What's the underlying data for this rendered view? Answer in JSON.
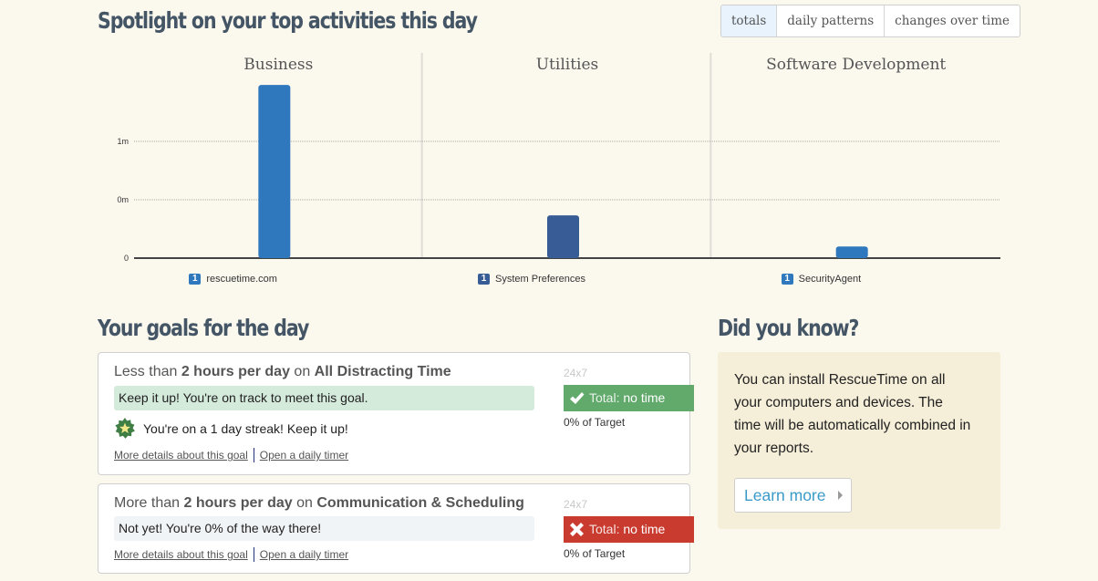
{
  "spotlight": {
    "title": "Spotlight on your top activities this day",
    "view_tabs": [
      {
        "label": "totals",
        "active": true
      },
      {
        "label": "daily patterns",
        "active": false
      },
      {
        "label": "changes over time",
        "active": false
      }
    ]
  },
  "chart_data": {
    "type": "bar",
    "title": "Spotlight on your top activities this day",
    "xlabel": "",
    "ylabel": "",
    "y_unit": "seconds",
    "ylim": [
      0,
      95
    ],
    "y_ticks": [
      {
        "value": 0,
        "label": "0"
      },
      {
        "value": 30,
        "label": "0m"
      },
      {
        "value": 60,
        "label": "1m"
      }
    ],
    "grid": true,
    "categories": [
      "Business",
      "Utilities",
      "Software Development"
    ],
    "series": [
      {
        "category": "Business",
        "rank": "1",
        "name": "rescuetime.com",
        "value": 89,
        "color": "#2f78bd"
      },
      {
        "category": "Utilities",
        "rank": "1",
        "name": "System Preferences",
        "value": 22,
        "color": "#385c96"
      },
      {
        "category": "Software Development",
        "rank": "1",
        "name": "SecurityAgent",
        "value": 6,
        "color": "#2f78bd"
      }
    ]
  },
  "goals": {
    "title": "Your goals for the day",
    "items": [
      {
        "prefix": "Less than ",
        "amount": "2 hours per day",
        "middle": " on ",
        "category": "All Distracting Time",
        "message": "Keep it up! You're on track to meet this goal.",
        "status": "ok",
        "streak": "You're on a 1 day streak! Keep it up!",
        "schedule": "24x7",
        "total_label": "Total:",
        "total_value": "no time",
        "percent": "0% of Target",
        "link_details": "More details about this goal",
        "link_timer": "Open a daily timer"
      },
      {
        "prefix": "More than ",
        "amount": "2 hours per day",
        "middle": " on ",
        "category": "Communication & Scheduling",
        "message": "Not yet! You're 0% of the way there!",
        "status": "fail",
        "schedule": "24x7",
        "total_label": "Total:",
        "total_value": "no time",
        "percent": "0% of Target",
        "link_details": "More details about this goal",
        "link_timer": "Open a daily timer"
      }
    ]
  },
  "did_you_know": {
    "title": "Did you know?",
    "text": "You can install RescueTime on all your computers and devices. The time will be automatically combined in your reports.",
    "button": "Learn more"
  },
  "colors": {
    "background": "#fbf8ee",
    "heading": "#445566",
    "success": "#62a96c",
    "danger": "#c93a2f",
    "link_accent": "#3a9ac8"
  }
}
